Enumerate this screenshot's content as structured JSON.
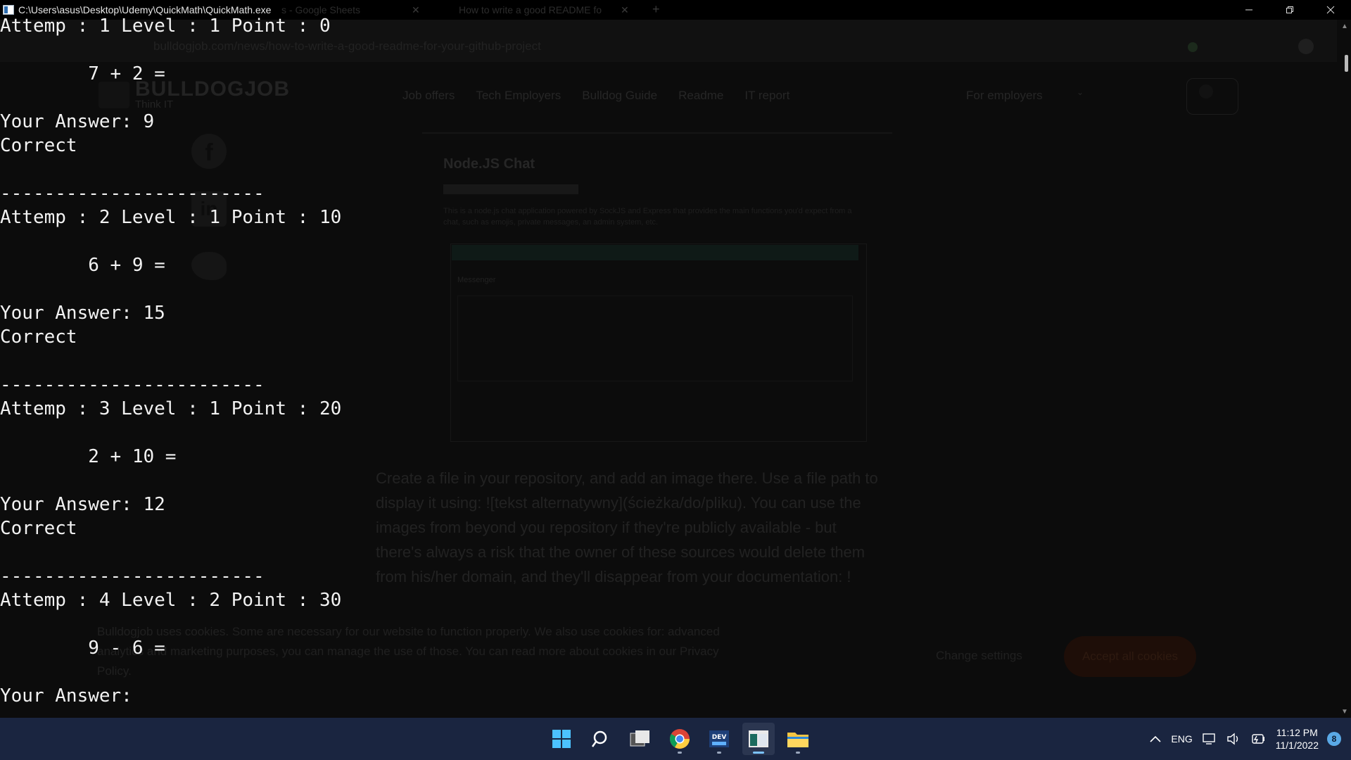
{
  "window": {
    "title": "C:\\Users\\asus\\Desktop\\Udemy\\QuickMath\\QuickMath.exe"
  },
  "console_lines": [
    "Attemp : 1 Level : 1 Point : 0",
    "        7 + 2 =",
    "Your Answer: 9",
    "Correct",
    "------------------------",
    "Attemp : 2 Level : 1 Point : 10",
    "        6 + 9 =",
    "Your Answer: 15",
    "Correct",
    "------------------------",
    "Attemp : 3 Level : 1 Point : 20",
    "        2 + 10 =",
    "Your Answer: 12",
    "Correct",
    "------------------------",
    "Attemp : 4 Level : 2 Point : 30",
    "        9 - 6 =",
    "Your Answer:"
  ],
  "background_page": {
    "tab_1": "s - Google Sheets",
    "tab_2": "How to write a good README fo",
    "address": "bulldogjob.com/news/how-to-write-a-good-readme-for-your-github-project",
    "brand": "BULLDOGJOB",
    "brand_tagline": "Think IT",
    "nav": [
      "Job offers",
      "Tech Employers",
      "Bulldog Guide",
      "Readme",
      "IT report"
    ],
    "for_employers": "For employers",
    "card_title": "Node.JS Chat",
    "card_desc": "This is a node.js chat application powered by SockJS and Express that provides the main functions you'd expect from a chat, such as emojis, private messages, an admin system, etc.",
    "card_inner_title": "Messenger",
    "article_lines": [
      "Create a file in your repository, and add an image there. Use a file path to",
      "display it using: ![tekst alternatywny](ścieżka/do/pliku). You can use the",
      "images from beyond you repository if they're publicly available - but",
      "there's always a risk that the owner of these sources would delete them",
      "from his/her domain, and they'll disappear from your documentation: !"
    ],
    "cookie_text_1": "Bulldogjob uses cookies. Some are necessary for our website to function properly. We also use cookies for: advanced",
    "cookie_text_2": "analytics and marketing purposes, you can manage the use of those. You can read more about cookies in our Privacy",
    "cookie_text_3": "Policy.",
    "change_settings": "Change settings",
    "accept_cookies": "Accept all cookies"
  },
  "taskbar": {
    "language": "ENG",
    "time": "11:12 PM",
    "date": "11/1/2022",
    "notifications": "8"
  }
}
